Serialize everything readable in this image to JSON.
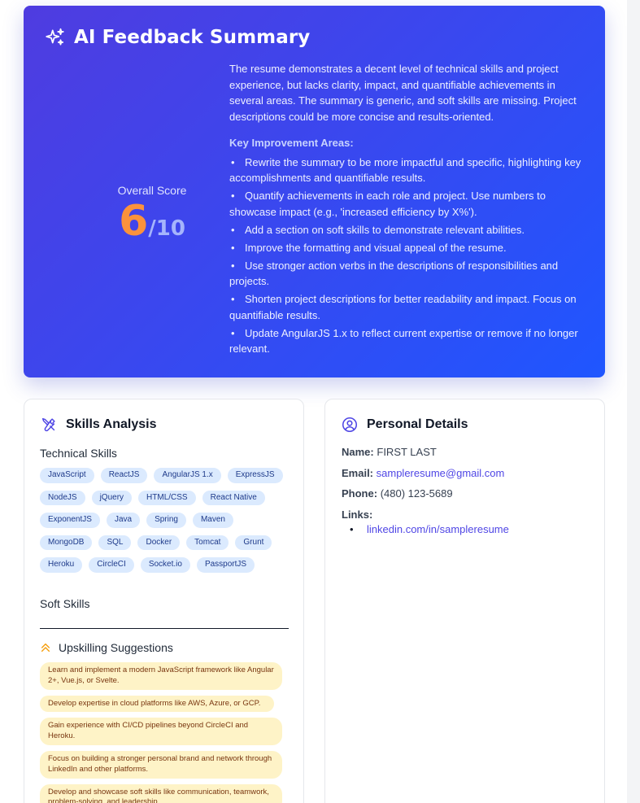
{
  "summary": {
    "title": "AI Feedback Summary",
    "score_label": "Overall Score",
    "score": "6",
    "score_max": "/10",
    "overview": "The resume demonstrates a decent level of technical skills and project experience, but lacks clarity, impact, and quantifiable achievements in several areas. The summary is generic, and soft skills are missing. Project descriptions could be more concise and results-oriented.",
    "key_title": "Key Improvement Areas:",
    "key_areas": [
      "Rewrite the summary to be more impactful and specific, highlighting key accomplishments and quantifiable results.",
      "Quantify achievements in each role and project. Use numbers to showcase impact (e.g., 'increased efficiency by X%').",
      "Add a section on soft skills to demonstrate relevant abilities.",
      "Improve the formatting and visual appeal of the resume.",
      "Use stronger action verbs in the descriptions of responsibilities and projects.",
      "Shorten project descriptions for better readability and impact. Focus on quantifiable results.",
      "Update AngularJS 1.x to reflect current expertise or remove if no longer relevant."
    ]
  },
  "skills": {
    "title": "Skills Analysis",
    "technical_title": "Technical Skills",
    "technical": [
      "JavaScript",
      "ReactJS",
      "AngularJS 1.x",
      "ExpressJS",
      "NodeJS",
      "jQuery",
      "HTML/CSS",
      "React Native",
      "ExponentJS",
      "Java",
      "Spring",
      "Maven",
      "MongoDB",
      "SQL",
      "Docker",
      "Tomcat",
      "Grunt",
      "Heroku",
      "CircleCI",
      "Socket.io",
      "PassportJS"
    ],
    "soft_title": "Soft Skills",
    "upskilling_title": "Upskilling Suggestions",
    "upskilling": [
      "Learn and implement a modern JavaScript framework like Angular 2+, Vue.js, or Svelte.",
      "Develop expertise in cloud platforms like AWS, Azure, or GCP.",
      "Gain experience with CI/CD pipelines beyond CircleCI and Heroku.",
      "Focus on building a stronger personal brand and network through LinkedIn and other platforms.",
      "Develop and showcase soft skills like communication, teamwork, problem-solving, and leadership."
    ]
  },
  "personal": {
    "title": "Personal Details",
    "name_label": "Name:",
    "name": "FIRST LAST",
    "email_label": "Email:",
    "email": "sampleresume@gmail.com",
    "phone_label": "Phone:",
    "phone": "(480) 123-5689",
    "links_label": "Links:",
    "links": [
      "linkedin.com/in/sampleresume"
    ]
  },
  "colors": {
    "gradient_start": "#4f3ce0",
    "gradient_end": "#1f56ff",
    "score": "#fb923c",
    "tag_bg": "#dbeafe",
    "suggestion_bg": "#fef3c7",
    "link": "#4f46e5"
  }
}
